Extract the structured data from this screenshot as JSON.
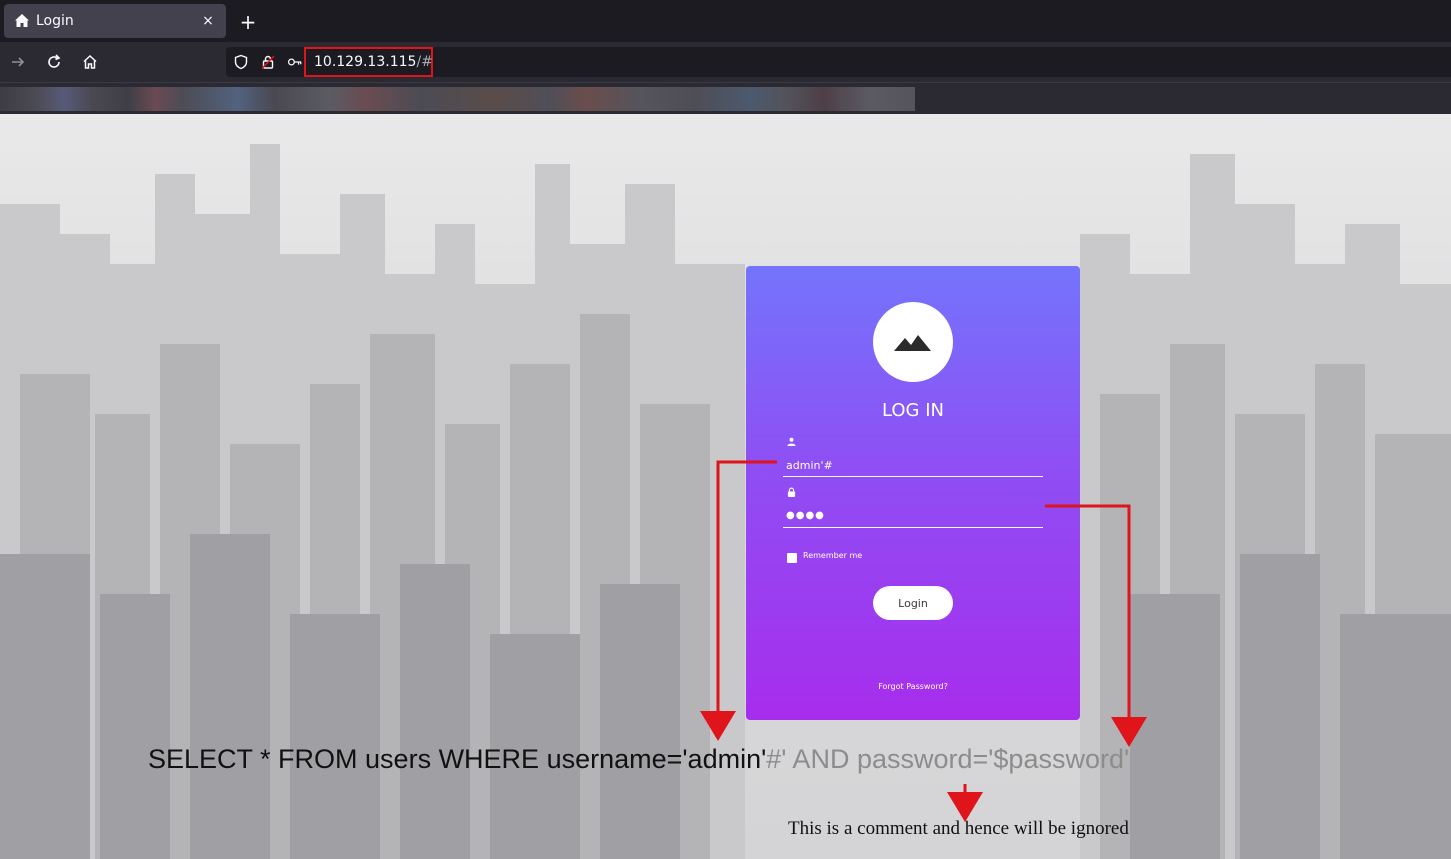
{
  "browser": {
    "tab": {
      "title": "Login",
      "icon": "home-icon",
      "close_label": "×"
    },
    "new_tab_label": "+",
    "url": {
      "host": "10.129.13.115",
      "path": "/#"
    },
    "colors": {
      "url_highlight": "#e0141b"
    }
  },
  "login_card": {
    "logo_icon": "mountain-icon",
    "title": "LOG IN",
    "username_icon": "user-icon",
    "username_value": "admin'#",
    "password_icon": "lock-icon",
    "password_value": "●●●●",
    "remember_label": "Remember me",
    "login_label": "Login",
    "forgot_label": "Forgot Password?",
    "colors": {
      "gradient_top": "#7474fd",
      "gradient_bottom": "#a72ded"
    }
  },
  "annotation": {
    "sql_active": "SELECT * FROM users WHERE username='admin'",
    "sql_commented": "#' AND password='$password'",
    "comment_note": "This is a comment and hence will be ignored",
    "arrow_color": "#e0141b"
  }
}
